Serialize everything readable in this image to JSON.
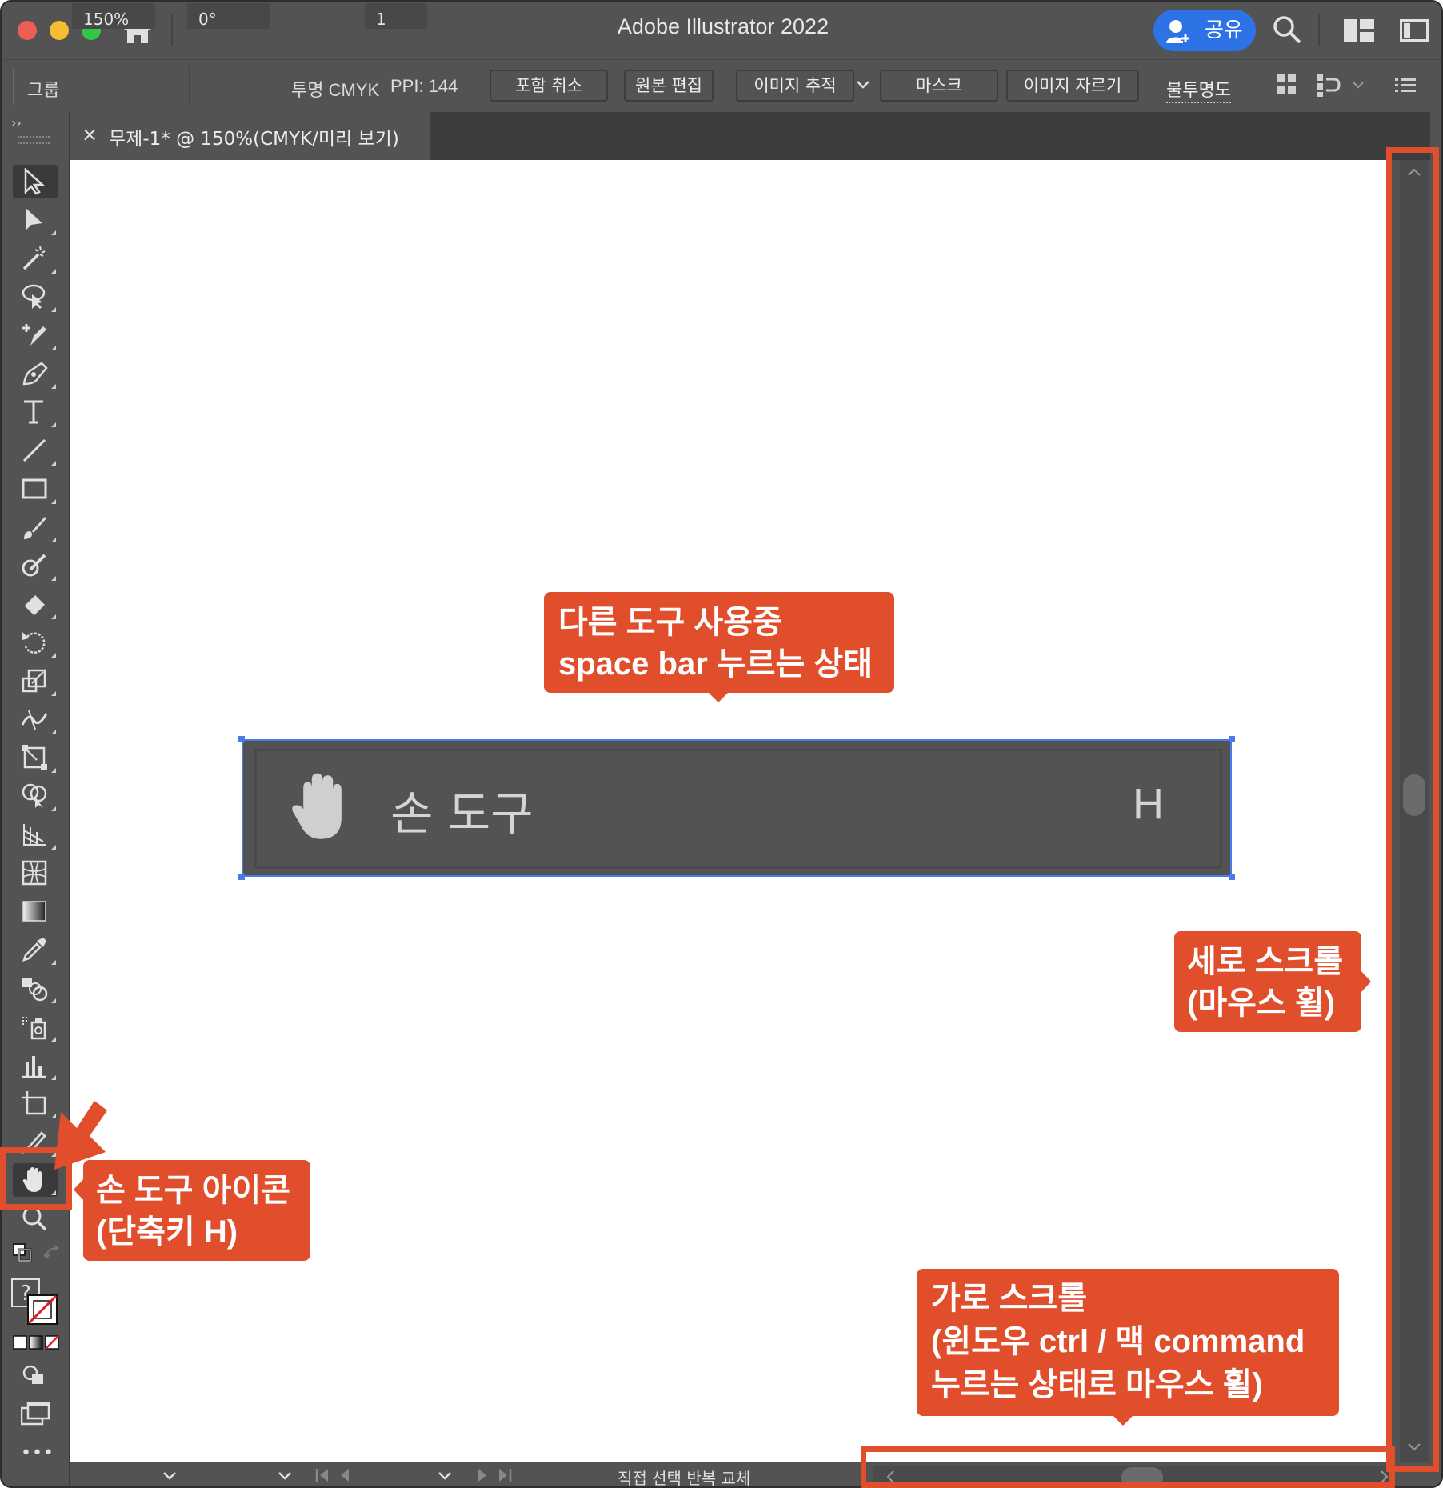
{
  "window": {
    "title": "Adobe Illustrator 2022",
    "share_label": "공유"
  },
  "control_bar": {
    "group_label": "그룹",
    "image_info": "투명 CMYK",
    "ppi": "PPI: 144",
    "btn_embed_cancel": "포함 취소",
    "btn_edit_original": "원본 편집",
    "btn_image_trace": "이미지 추적",
    "btn_mask": "마스크",
    "btn_crop_image": "이미지 자르기",
    "opacity_label": "불투명도"
  },
  "document_tab": {
    "close": "×",
    "title": "무제-1* @ 150%(CMYK/미리 보기)"
  },
  "canvas_group": {
    "tool_name": "손 도구",
    "shortcut": "H"
  },
  "statusbar": {
    "zoom": "150%",
    "rotation": "0°",
    "artboard": "1",
    "status_text": "직접 선택 반복 교체"
  },
  "callouts": {
    "spacebar": [
      "다른 도구 사용중",
      "space bar 누르는 상태"
    ],
    "vertical": [
      "세로 스크롤",
      "(마우스 휠)"
    ],
    "hand_icon": [
      "손 도구 아이콘",
      "(단축키 H)"
    ],
    "horizontal": [
      "가로 스크롤",
      "(윈도우 ctrl / 맥 command",
      "누르는 상태로 마우스 휠)"
    ]
  },
  "colors": {
    "ui_gray": "#535353",
    "accent_blue": "#2e73e6",
    "callout_red": "#e04e2c",
    "selection_blue": "#4a79e8"
  },
  "toolbar": {
    "collapse": "››",
    "more": "•••",
    "unknown_swatch": "?"
  }
}
